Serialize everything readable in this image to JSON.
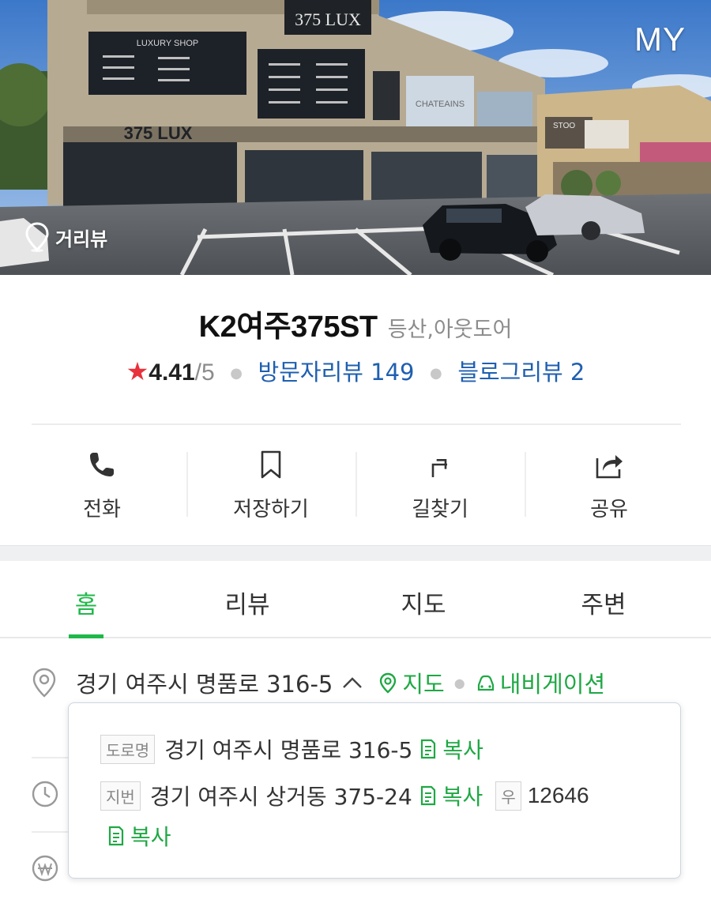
{
  "hero": {
    "badge": "MY",
    "street_view_label": "거리뷰",
    "sign_1": "375 LUX",
    "sign_2": "375 LUX",
    "sign_3": "LUXURY SHOP",
    "sign_4": "CHATEAINS",
    "sign_5": "STOO"
  },
  "place": {
    "name": "K2여주375ST",
    "category": "등산,아웃도어",
    "rating": "4.41",
    "rating_max": "/5",
    "visitor_reviews": "방문자리뷰 149",
    "blog_reviews": "블로그리뷰 2"
  },
  "actions": [
    {
      "label": "전화",
      "icon": "phone-icon"
    },
    {
      "label": "저장하기",
      "icon": "bookmark-icon"
    },
    {
      "label": "길찾기",
      "icon": "directions-icon"
    },
    {
      "label": "공유",
      "icon": "share-icon"
    }
  ],
  "tabs": [
    {
      "label": "홈",
      "active": true
    },
    {
      "label": "리뷰",
      "active": false
    },
    {
      "label": "지도",
      "active": false
    },
    {
      "label": "주변",
      "active": false
    }
  ],
  "address": {
    "text": "경기 여주시 명품로 316-5",
    "map_link": "지도",
    "nav_link": "내비게이션"
  },
  "popover": {
    "road_tag": "도로명",
    "road_address": "경기 여주시 명품로 316-5",
    "jibun_tag": "지번",
    "jibun_address": "경기 여주시 상거동 375-24",
    "zip_tag": "우",
    "zipcode": "12646",
    "copy_label": "복사"
  },
  "colors": {
    "accent_green": "#1fb84a",
    "link_blue": "#1f5fb0",
    "star_red": "#e8313b"
  }
}
